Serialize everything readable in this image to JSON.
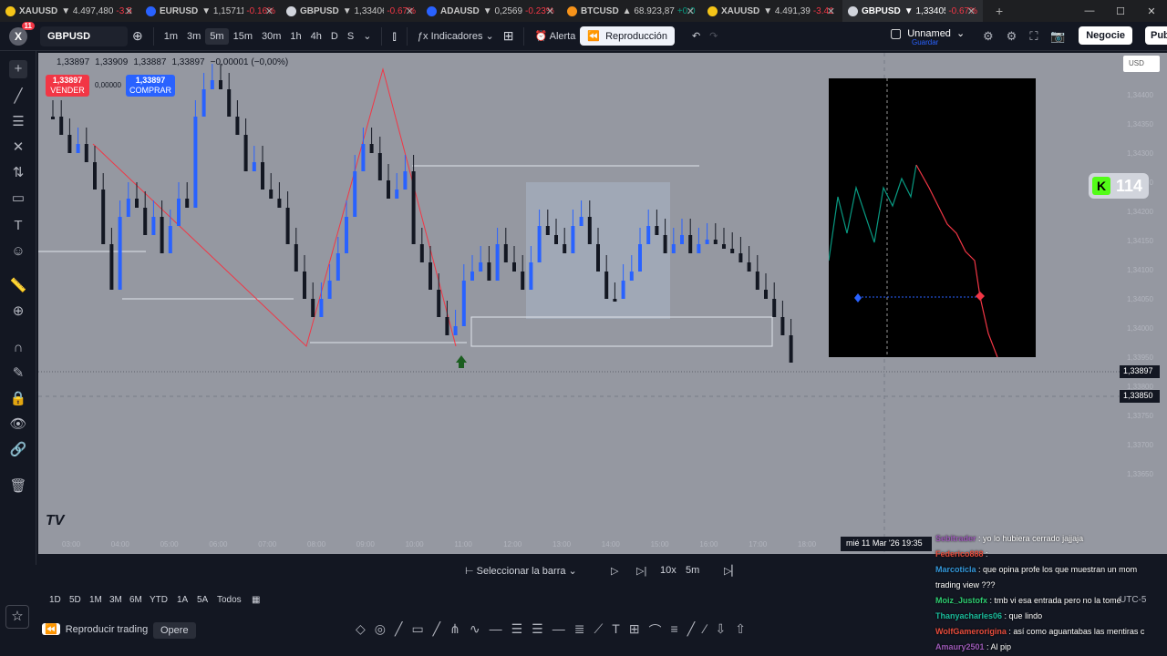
{
  "browser_tabs": [
    {
      "symbol": "XAUUSD",
      "price": "4.497,480",
      "change": "-3.5",
      "direction": "down",
      "icon_color": "#f5c518"
    },
    {
      "symbol": "EURUSD",
      "price": "1,15711",
      "change": "-0.16%",
      "direction": "down",
      "icon_color": "#2962ff"
    },
    {
      "symbol": "GBPUSD",
      "price": "1,33406",
      "change": "-0.67%",
      "direction": "down",
      "icon_color": "#d1d4dc"
    },
    {
      "symbol": "ADAUSD",
      "price": "0,2569",
      "change": "-0.23%",
      "direction": "down",
      "icon_color": "#2962ff"
    },
    {
      "symbol": "BTCUSD",
      "price": "68.923,87",
      "change": "+0.0",
      "direction": "up",
      "icon_color": "#f7931a"
    },
    {
      "symbol": "XAUUSD",
      "price": "4.491,39",
      "change": "-3.41",
      "direction": "down",
      "icon_color": "#f5c518"
    },
    {
      "symbol": "GBPUSD",
      "price": "1,33405",
      "change": "-0.67%",
      "direction": "down",
      "icon_color": "#d1d4dc",
      "active": true
    }
  ],
  "toolbar": {
    "notif_count": "11",
    "symbol": "GBPUSD",
    "intervals": [
      "1m",
      "3m",
      "5m",
      "15m",
      "30m",
      "1h",
      "4h",
      "D",
      "S"
    ],
    "selected_interval": "5m",
    "indicators_label": "Indicadores",
    "alert_label": "Alerta",
    "replay_label": "Reproducción",
    "layout_name": "Unnamed",
    "layout_sub": "Guardar",
    "negocie_label": "Negocie",
    "publish_label": "Publ"
  },
  "chart": {
    "ohlc": [
      "1,33897",
      "1,33909",
      "1,33887",
      "1,33897",
      "−0,00001 (−0,00%)"
    ],
    "sell_price": "1,33897",
    "sell_label": "VENDER",
    "spread": "0,00000",
    "buy_price": "1,33897",
    "buy_label": "COMPRAR",
    "currency": "USD",
    "last_price_tag": "1,33897",
    "crosshair_price_tag": "1,33850",
    "price_axis": [
      "1,34400",
      "1,34350",
      "1,34300",
      "1,34250",
      "1,34200",
      "1,34150",
      "1,34100",
      "1,34050",
      "1,34000",
      "1,33950",
      "1,33800",
      "1,33750",
      "1,33700",
      "1,33650"
    ],
    "time_axis": [
      "03:00",
      "04:00",
      "05:00",
      "06:00",
      "07:00",
      "08:00",
      "09:00",
      "10:00",
      "11:00",
      "12:00",
      "13:00",
      "14:00",
      "15:00",
      "16:00",
      "17:00",
      "18:00"
    ],
    "date_label": "mié 11 Mar '26   19:35",
    "counter_value": "114",
    "logo": "TV"
  },
  "replay_bar": {
    "select_bar": "Seleccionar la barra",
    "speed": "10x",
    "interval": "5m"
  },
  "ranges": [
    "1D",
    "5D",
    "1M",
    "3M",
    "6M",
    "YTD",
    "1A",
    "5A",
    "Todos"
  ],
  "bottom": {
    "play_trading": "Reproducir trading",
    "opere": "Opere"
  },
  "timezone": "UTC-5",
  "chat": [
    {
      "user": "Sebitrader",
      "text": ": yo lo hubiera cerrado jajjaja",
      "color": "#9b59b6"
    },
    {
      "user": "Federico888",
      "text": ":",
      "color": "#e74c3c"
    },
    {
      "user": "Marcoticla",
      "text": ": que opina profe los que muestran un mom",
      "color": "#3498db"
    },
    {
      "user": "",
      "text": "trading view ???",
      "color": "#fff"
    },
    {
      "user": "Moiz_Justofx",
      "text": ": tmb vi esa entrada pero no la tomé",
      "color": "#2ecc71"
    },
    {
      "user": "Thanyacharles06",
      "text": ": que lindo",
      "color": "#1abc9c"
    },
    {
      "user": "WolfGamerorigina",
      "text": ": así como aguantabas las mentiras c",
      "color": "#e74c3c"
    },
    {
      "user": "Amaury2501",
      "text": ": Al pip",
      "color": "#9b59b6"
    }
  ]
}
